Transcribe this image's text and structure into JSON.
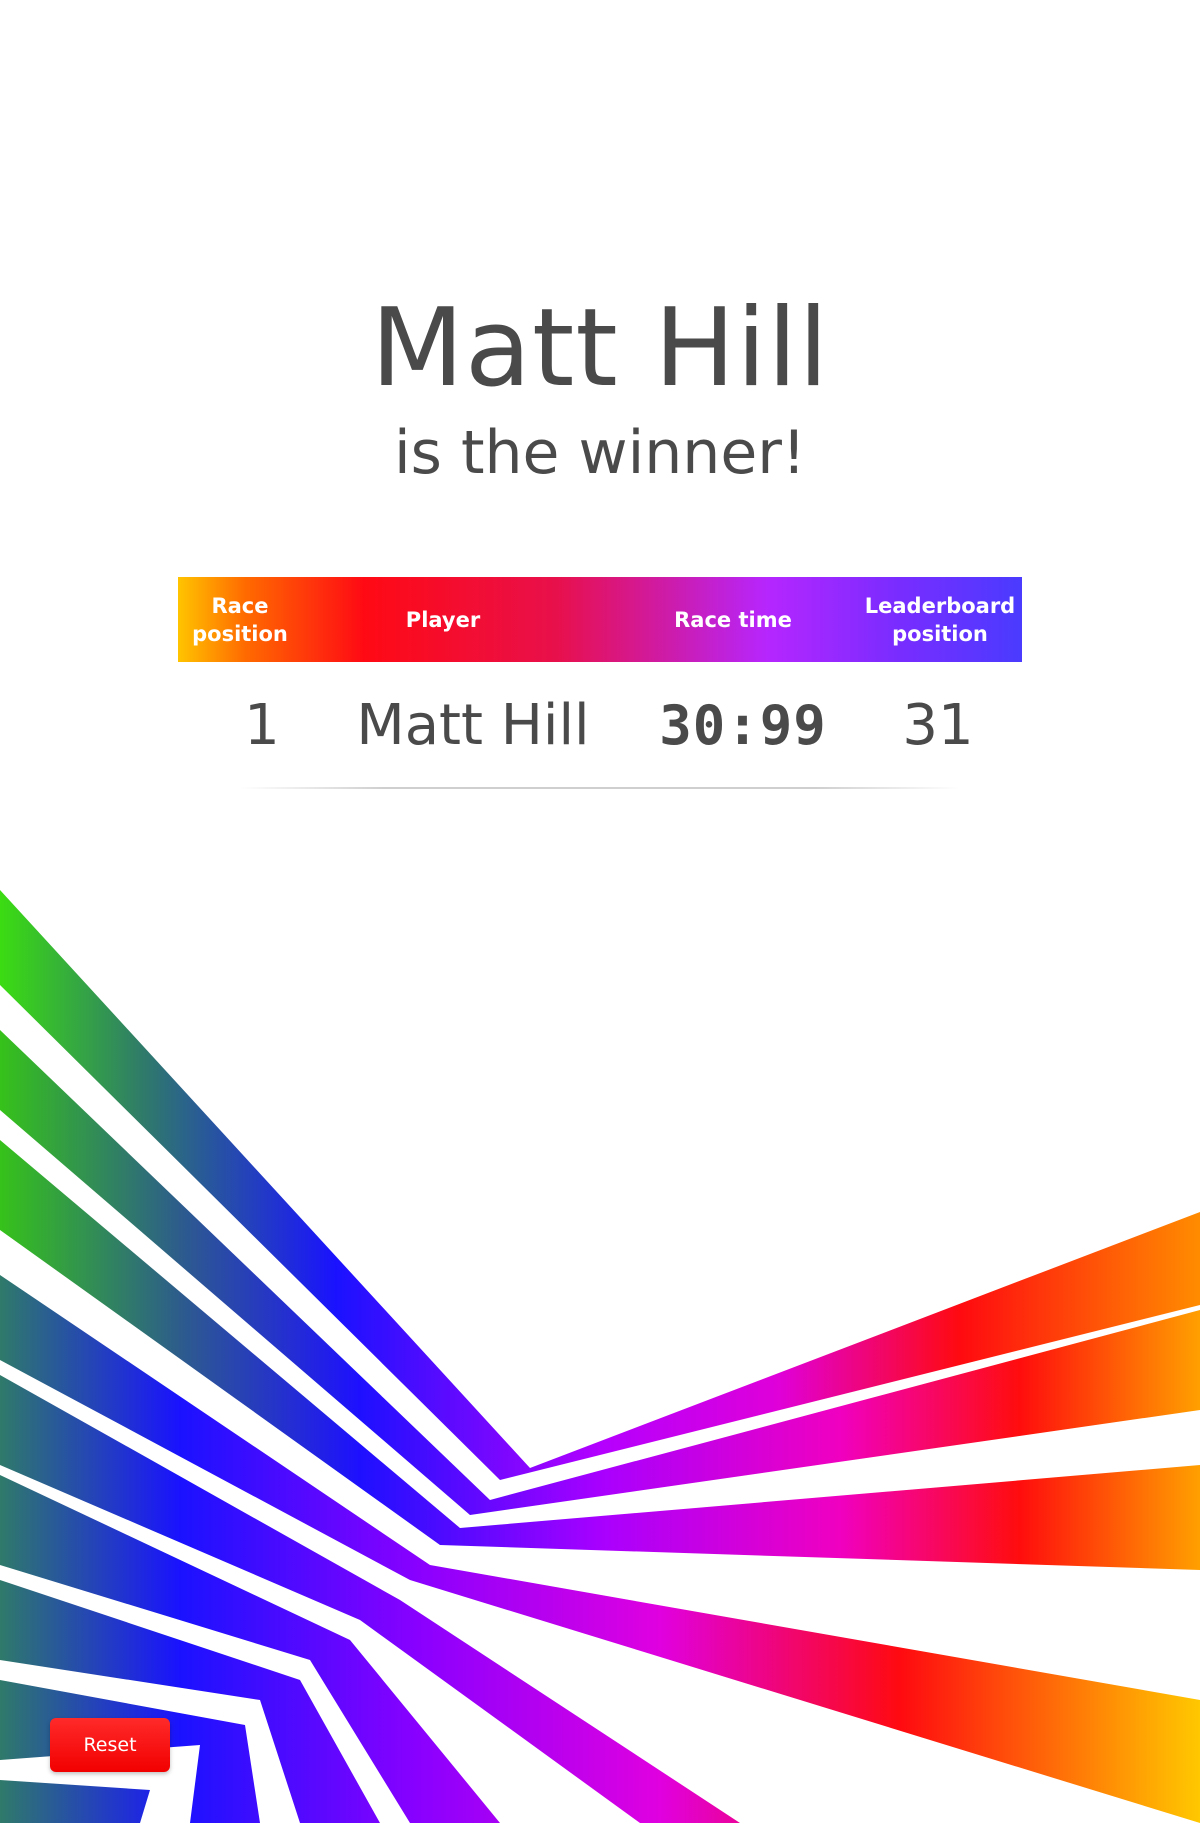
{
  "winner": {
    "name": "Matt Hill",
    "subtitle": "is the winner!"
  },
  "results_table": {
    "headers": {
      "race_position": "Race position",
      "player": "Player",
      "race_time": "Race time",
      "leaderboard_position": "Leaderboard position"
    },
    "rows": [
      {
        "race_position": "1",
        "player": "Matt Hill",
        "race_time": "30:99",
        "leaderboard_position": "31"
      }
    ]
  },
  "controls": {
    "reset_label": "Reset"
  },
  "colors": {
    "text": "#4a4a4a",
    "reset_button": "#ff0000",
    "header_gradient": [
      "#ffc400",
      "#ff0a14",
      "#b526ff",
      "#4a3bff"
    ]
  }
}
